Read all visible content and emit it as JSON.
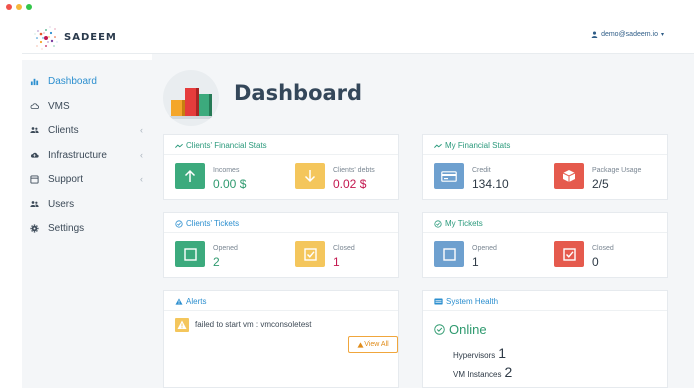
{
  "brand": {
    "name": "SADEEM"
  },
  "header": {
    "user_email": "demo@sadeem.io"
  },
  "sidebar": {
    "items": [
      {
        "label": "Dashboard",
        "icon": "bar-chart-icon",
        "active": true
      },
      {
        "label": "VMS",
        "icon": "cloud-icon"
      },
      {
        "label": "Clients",
        "icon": "users-icon"
      },
      {
        "label": "Infrastructure",
        "icon": "cloud-upload-icon"
      },
      {
        "label": "Support",
        "icon": "support-icon"
      },
      {
        "label": "Users",
        "icon": "user-group-icon"
      },
      {
        "label": "Settings",
        "icon": "gear-icon"
      }
    ]
  },
  "main": {
    "title": "Dashboard",
    "clients_financial": {
      "title": "Clients' Financial Stats",
      "incomes_label": "Incomes",
      "incomes_value": "0.00 $",
      "debts_label": "Clients' debts",
      "debts_value": "0.02 $"
    },
    "my_financial": {
      "title": "My Financial Stats",
      "credit_label": "Credit",
      "credit_value": "134.10",
      "usage_label": "Package Usage",
      "usage_value": "2/5"
    },
    "clients_tickets": {
      "title": "Clients' Tickets",
      "opened_label": "Opened",
      "opened_value": "2",
      "closed_label": "Closed",
      "closed_value": "1"
    },
    "my_tickets": {
      "title": "My Tickets",
      "opened_label": "Opened",
      "opened_value": "1",
      "closed_label": "Closed",
      "closed_value": "0"
    },
    "alerts": {
      "title": "Alerts",
      "message": "failed to start vm : vmconsoletest",
      "view_all_label": "View All"
    },
    "system_health": {
      "title": "System Health",
      "status": "Online",
      "hypervisors_label": "Hypervisors",
      "hypervisors_value": "1",
      "vm_instances_label": "VM Instances",
      "vm_instances_value": "2"
    }
  },
  "colors": {
    "accent_blue": "#2c8fcf",
    "accent_green": "#2b9a7c",
    "income_green": "#3caa7d",
    "debt_yellow": "#f4c65c",
    "credit_blue": "#6ea0cf",
    "usage_red": "#e55a4d",
    "debt_value": "#c3174f"
  }
}
